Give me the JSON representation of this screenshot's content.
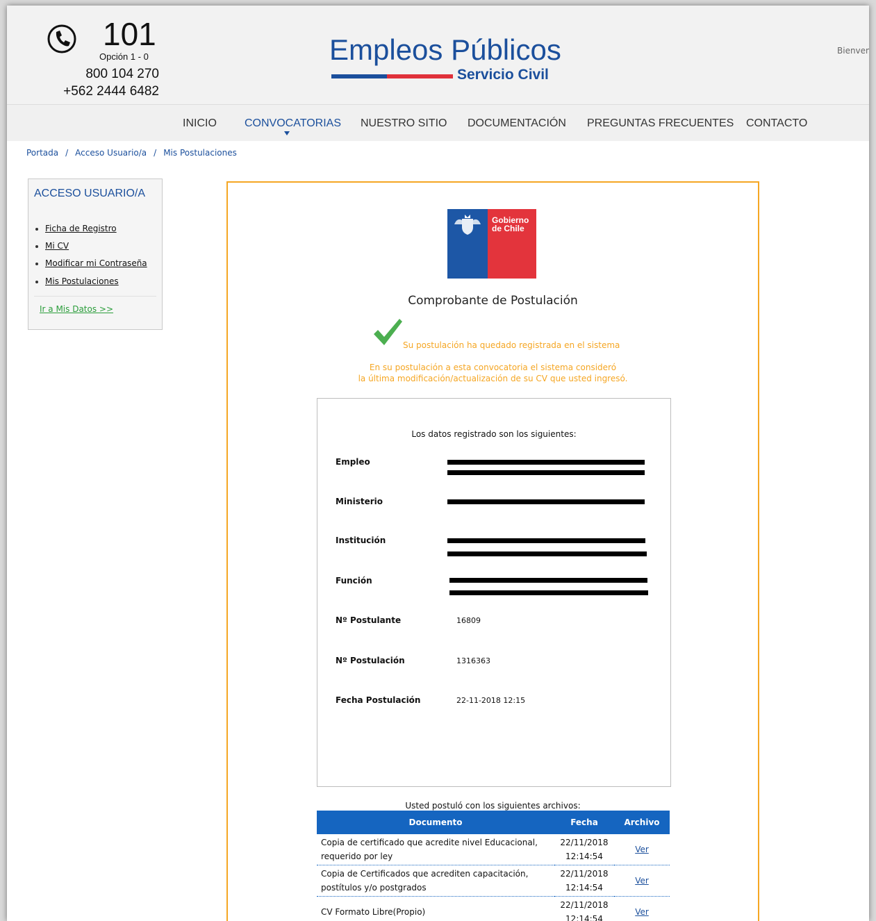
{
  "header": {
    "phone_number": "101",
    "phone_option": "Opción 1 - 0",
    "phone_line_1": "800 104 270",
    "phone_line_2": "+562 2444 6482",
    "logo_title": "Empleos Públicos",
    "logo_subtitle": "Servicio Civil",
    "welcome": "Bienven"
  },
  "nav": {
    "items": [
      "INICIO",
      "CONVOCATORIAS",
      "NUESTRO SITIO",
      "DOCUMENTACIÓN",
      "PREGUNTAS FRECUENTES",
      "CONTACTO"
    ],
    "active": "CONVOCATORIAS"
  },
  "breadcrumb": {
    "items": [
      "Portada",
      "Acceso Usuario/a",
      "Mis Postulaciones"
    ],
    "separator": "/"
  },
  "sidebar": {
    "title": "ACCESO USUARIO/A",
    "items": [
      {
        "label": "Ficha de Registro"
      },
      {
        "label": "Mi CV"
      },
      {
        "label": "Modificar mi Contraseña"
      },
      {
        "label": "Mis Postulaciones"
      }
    ],
    "more_link": "Ir a Mis Datos >>"
  },
  "receipt": {
    "gov_logo_text_1": "Gobierno",
    "gov_logo_text_2": "de Chile",
    "title": "Comprobante de Postulación",
    "success_message": "Su postulación ha quedado registrada en el sistema",
    "info_line_1": "En su postulación a esta convocatoria el sistema consideró",
    "info_line_2": "la última modificación/actualización de su CV que usted ingresó.",
    "data_heading": "Los datos registrado son los siguientes:",
    "labels": {
      "empleo": "Empleo",
      "ministerio": "Ministerio",
      "institucion": "Institución",
      "funcion": "Función",
      "postulante": "Nº Postulante",
      "postulacion": "Nº Postulación",
      "fecha": "Fecha Postulación"
    },
    "values": {
      "postulante": "16809",
      "postulacion": "1316363",
      "fecha": "22-11-2018 12:15"
    }
  },
  "files": {
    "title": "Usted postuló con los siguientes archivos:",
    "columns": [
      "Documento",
      "Fecha",
      "Archivo"
    ],
    "rows": [
      {
        "documento": "Copia de certificado que acredite nivel Educacional, requerido por ley",
        "fecha": "22/11/2018\n12:14:54",
        "archivo": "Ver"
      },
      {
        "documento": "Copia de Certificados que acrediten capacitación, postítulos y/o postgrados",
        "fecha": "22/11/2018\n12:14:54",
        "archivo": "Ver"
      },
      {
        "documento": "CV Formato Libre(Propio)",
        "fecha": "22/11/2018\n12:14:54",
        "archivo": "Ver"
      }
    ]
  },
  "colors": {
    "brand_blue": "#1b4f9c",
    "brand_red": "#e0313a",
    "accent_orange": "#f5a623",
    "table_header": "#1565c0",
    "success_green": "#4caf50"
  }
}
